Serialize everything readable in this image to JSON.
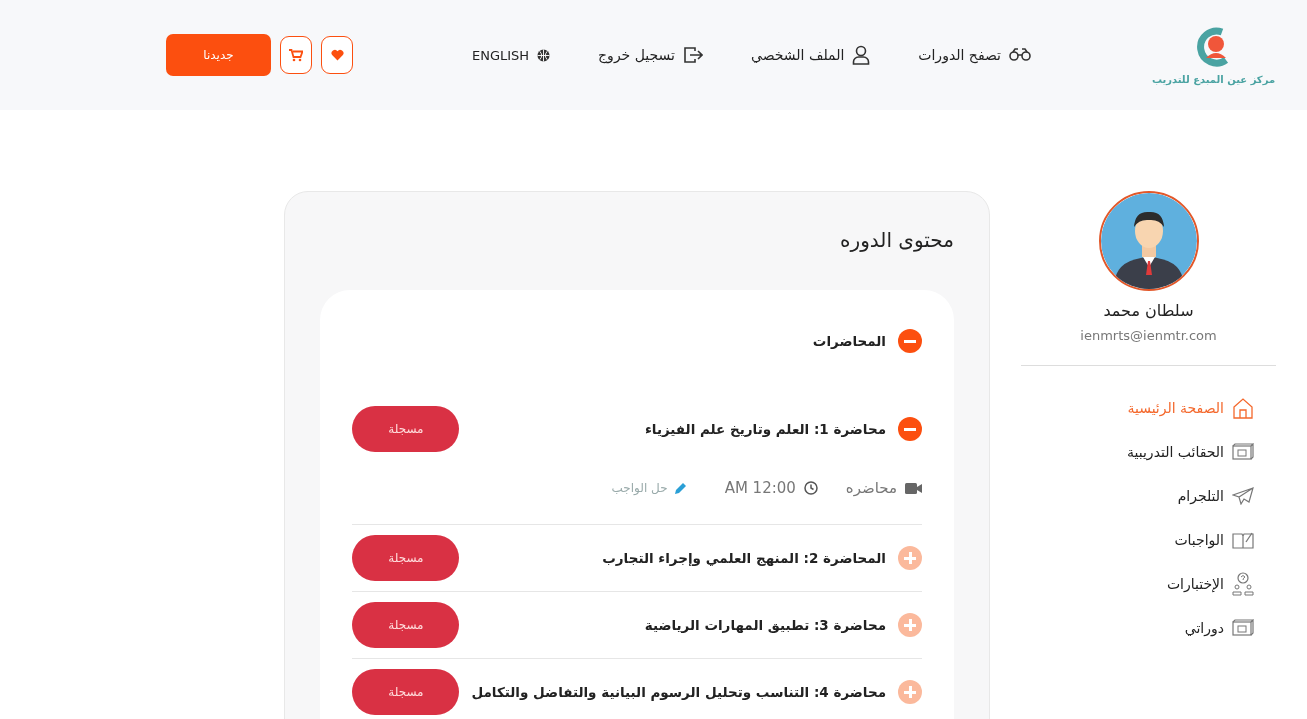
{
  "header": {
    "logo_text": "مركز عين المبدع للتدريب",
    "nav": [
      {
        "kind": "browse",
        "label": "تصفح الدورات"
      },
      {
        "kind": "profile",
        "label": "الملف الشخصي"
      },
      {
        "kind": "logout",
        "label": "تسجيل خروج"
      },
      {
        "kind": "language",
        "label": "ENGLISH"
      }
    ],
    "cta": "جديدنا"
  },
  "profile": {
    "name": "سلطان محمد",
    "email": "ienmrts@ienmtr.com"
  },
  "sidebar": {
    "items": [
      {
        "kind": "home",
        "label": "الصفحة الرئيسية",
        "selected": true
      },
      {
        "kind": "bag",
        "label": "الحقائب التدريبية",
        "selected": false
      },
      {
        "kind": "telegram",
        "label": "التلجرام",
        "selected": false
      },
      {
        "kind": "homework",
        "label": "الواجبات",
        "selected": false
      },
      {
        "kind": "exam",
        "label": "الإختبارات",
        "selected": false
      },
      {
        "kind": "bag",
        "label": "دوراتي",
        "selected": false
      }
    ]
  },
  "content": {
    "title": "محتوى الدوره",
    "section": {
      "label": "المحاضرات",
      "expanded": true
    },
    "lectures": [
      {
        "title": "محاضرة 1: العلم وتاريخ علم الفيزياء",
        "expanded": true,
        "button": "مسجلة",
        "details": {
          "type": "محاضره",
          "time": "AM 12:00",
          "homework": "حل الواجب"
        }
      },
      {
        "title": "المحاضرة 2: المنهج العلمي وإجراء التجارب",
        "expanded": false,
        "button": "مسجلة"
      },
      {
        "title": "محاضرة 3: تطبيق المهارات الرياضية",
        "expanded": false,
        "button": "مسجلة"
      },
      {
        "title": "محاضرة 4: التناسب وتحليل الرسوم البيانية والتفاضل والتكامل",
        "expanded": false,
        "button": "مسجلة"
      }
    ]
  }
}
